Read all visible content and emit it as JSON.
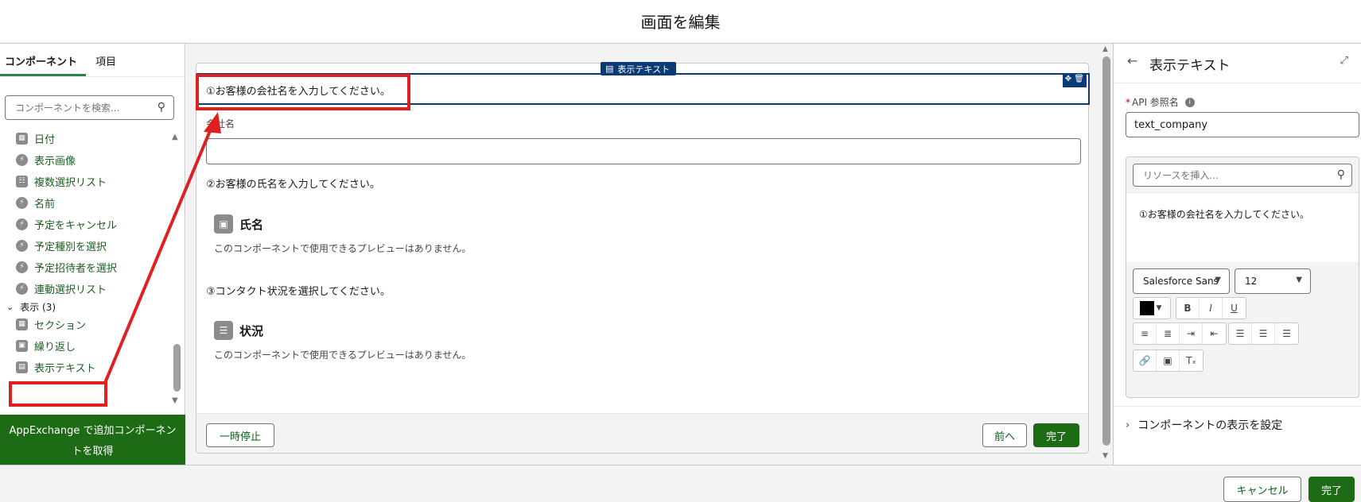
{
  "header": {
    "title": "画面を編集"
  },
  "left": {
    "tabs": [
      {
        "label": "コンポーネント"
      },
      {
        "label": "項目"
      }
    ],
    "search_placeholder": "コンポーネントを検索...",
    "items": [
      {
        "label": "日付"
      },
      {
        "label": "表示画像"
      },
      {
        "label": "複数選択リスト"
      },
      {
        "label": "名前"
      },
      {
        "label": "予定をキャンセル"
      },
      {
        "label": "予定種別を選択"
      },
      {
        "label": "予定招待者を選択"
      },
      {
        "label": "連動選択リスト"
      }
    ],
    "group": {
      "label": "表示 (3)"
    },
    "display_items": [
      {
        "label": "セクション"
      },
      {
        "label": "繰り返し"
      },
      {
        "label": "表示テキスト"
      }
    ],
    "appexchange_label": "AppExchange で追加コンポーネントを取得"
  },
  "canvas": {
    "selected_label": "表示テキスト",
    "q1": "①お客様の会社名を入力してください。",
    "company_label": "会社名",
    "q2": "②お客様の氏名を入力してください。",
    "name_component": "氏名",
    "no_preview_1": "このコンポーネントで使用できるプレビューはありません。",
    "q3": "③コンタクト状況を選択してください。",
    "status_component": "状況",
    "no_preview_2": "このコンポーネントで使用できるプレビューはありません。",
    "pause_button": "一時停止",
    "prev_button": "前へ",
    "finish_button": "完了"
  },
  "right": {
    "title": "表示テキスト",
    "api_label": "API 参照名",
    "api_value": "text_company",
    "resource_placeholder": "リソースを挿入...",
    "rte_text": "①お客様の会社名を入力してください。",
    "font_family": "Salesforce Sans",
    "font_size": "12",
    "set_visibility": "コンポーネントの表示を設定"
  },
  "footer": {
    "cancel_button": "キャンセル",
    "done_button": "完了"
  },
  "colors": {
    "brand_green": "#1e6b16",
    "link_green": "#1b5e20",
    "selection_blue": "#0b3b77",
    "annotation_red": "#e02020"
  }
}
